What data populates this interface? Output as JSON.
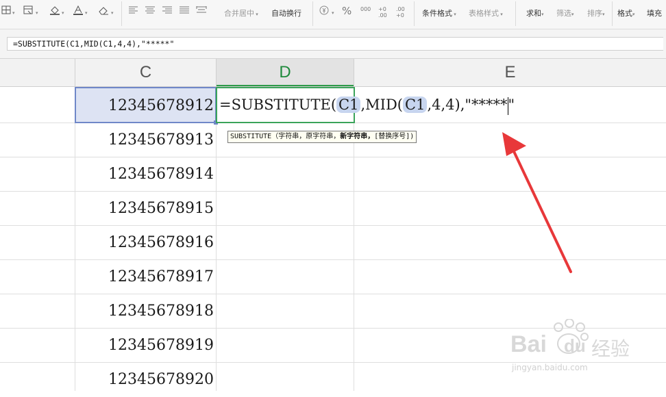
{
  "ribbon": {
    "merge_center": "合并居中",
    "auto_wrap": "自动换行",
    "conditional_format": "条件格式",
    "table_style": "表格样式",
    "sum": "求和",
    "filter": "筛选",
    "sort": "排序",
    "format": "格式",
    "fill": "填充",
    "percent": "%",
    "thousands": "000",
    "dec_inc": "+0 .00",
    "dec_dec": ".00 +0"
  },
  "formula_bar": {
    "value": "=SUBSTITUTE(C1,MID(C1,4,4),\"*****\""
  },
  "columns": [
    "C",
    "D",
    "E"
  ],
  "column_c_values": [
    "12345678912",
    "12345678913",
    "12345678914",
    "12345678915",
    "12345678916",
    "12345678917",
    "12345678918",
    "12345678919",
    "12345678920"
  ],
  "edit_cell": {
    "part1": "=SUBSTITUTE(",
    "ref1": "C1",
    "part2": ",MID(",
    "ref2": "C1",
    "part3": ",4,4),\"*****",
    "part4": "\""
  },
  "tooltip": {
    "func": "SUBSTITUTE（字符串，原字符串，",
    "bold": "新字符串，",
    "rest": "[替换序号])"
  },
  "watermark": {
    "brand": "Bai",
    "brand2": "du",
    "cn": "经验",
    "url": "jingyan.baidu.com"
  },
  "colors": {
    "accent_green": "#2e9a4a",
    "selection_blue": "#6f87c8",
    "arrow_red": "#e8383a"
  }
}
